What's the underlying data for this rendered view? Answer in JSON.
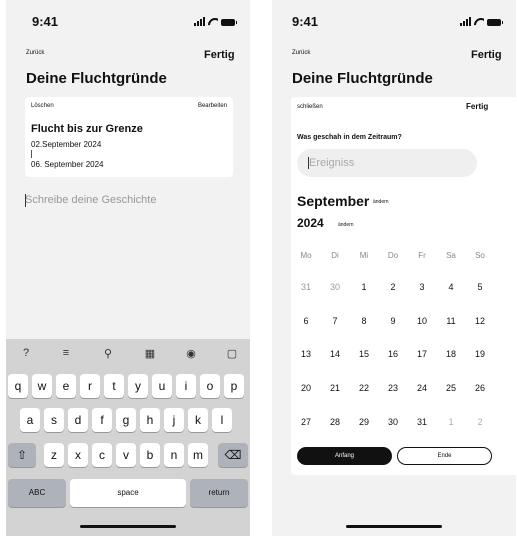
{
  "status_bar": {
    "time": "9:41"
  },
  "left_screen": {
    "nav": {
      "back_label": "Zurück",
      "done_label": "Fertig"
    },
    "title": "Deine Fluchtgründe",
    "card": {
      "delete_label": "Löschen",
      "edit_label": "Bearbeiten",
      "entry_title": "Flucht bis zur Grenze",
      "start_date": "02.September 2024",
      "end_date": "06. September 2024"
    },
    "story_placeholder": "Schreibe deine Geschichte",
    "keyboard": {
      "toolbar": [
        {
          "icon": "help-circle-icon",
          "glyph": "?"
        },
        {
          "icon": "list-icon",
          "glyph": "≡"
        },
        {
          "icon": "location-icon",
          "glyph": "⚲"
        },
        {
          "icon": "calendar-icon",
          "glyph": "▦"
        },
        {
          "icon": "camera-icon",
          "glyph": "◉"
        },
        {
          "icon": "document-icon",
          "glyph": "▢"
        }
      ],
      "row1": [
        "q",
        "w",
        "e",
        "r",
        "t",
        "y",
        "u",
        "i",
        "o",
        "p"
      ],
      "row2": [
        "a",
        "s",
        "d",
        "f",
        "g",
        "h",
        "j",
        "k",
        "l"
      ],
      "row3": [
        "z",
        "x",
        "c",
        "v",
        "b",
        "n",
        "m"
      ],
      "shift_glyph": "⇧",
      "delete_glyph": "⌫",
      "abc_label": "ABC",
      "space_label": "space",
      "return_label": "return"
    }
  },
  "right_screen": {
    "nav": {
      "back_label": "Zurück",
      "done_label": "Fertig"
    },
    "title": "Deine Fluchtgründe",
    "card": {
      "close_label": "schließen",
      "done_label": "Fertig",
      "question": "Was geschah in dem Zeitraum?",
      "event_placeholder": "Ereigniss",
      "month": "September",
      "month_change": "ändern",
      "year": "2024",
      "year_change": "ändern",
      "weekdays": [
        "Mo",
        "Di",
        "Mi",
        "Do",
        "Fr",
        "Sa",
        "So"
      ],
      "weeks": [
        [
          "31",
          "30",
          "1",
          "2",
          "3",
          "4",
          "5"
        ],
        [
          "6",
          "7",
          "8",
          "9",
          "10",
          "11",
          "12"
        ],
        [
          "13",
          "14",
          "15",
          "16",
          "17",
          "18",
          "19"
        ],
        [
          "20",
          "21",
          "22",
          "23",
          "24",
          "25",
          "26"
        ],
        [
          "27",
          "28",
          "29",
          "30",
          "31",
          "1",
          "2"
        ]
      ],
      "start_button": "Anfang",
      "end_button": "Ende"
    }
  }
}
